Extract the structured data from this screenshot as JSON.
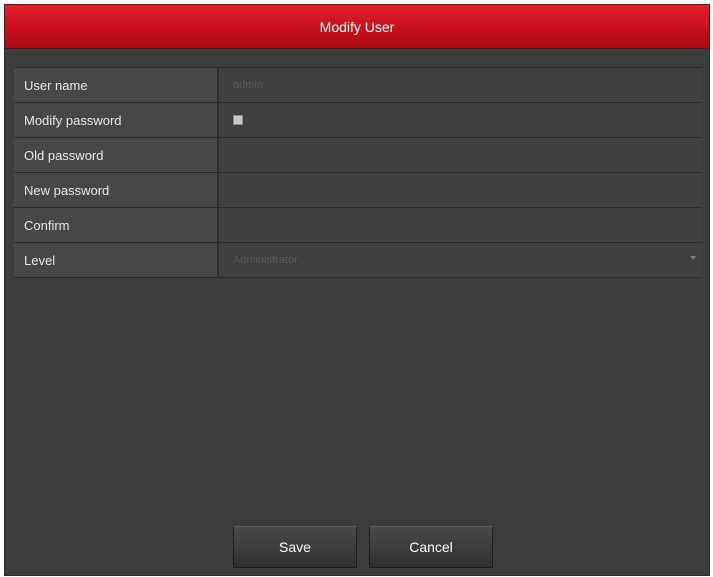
{
  "dialog": {
    "title": "Modify User"
  },
  "form": {
    "rows": [
      {
        "label": "User name",
        "value": "admin"
      },
      {
        "label": "Modify password",
        "checked": false
      },
      {
        "label": "Old password",
        "value": ""
      },
      {
        "label": "New password",
        "value": ""
      },
      {
        "label": "Confirm",
        "value": ""
      },
      {
        "label": "Level",
        "value": "Administrator"
      }
    ]
  },
  "buttons": {
    "save_label": "Save",
    "cancel_label": "Cancel"
  },
  "colors": {
    "title_bar": "#c8101c",
    "background": "#3c3c3c",
    "label_cell": "#474747",
    "value_cell": "#3f3f3f"
  },
  "icons": {
    "level_dropdown": "chevron-down-icon"
  }
}
